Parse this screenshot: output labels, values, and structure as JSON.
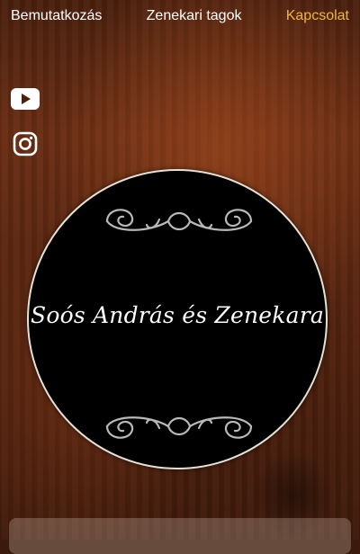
{
  "nav": {
    "items": [
      {
        "label": "Bemutatkozás"
      },
      {
        "label": "Zenekari tagok"
      },
      {
        "label": "Kapcsolat"
      }
    ],
    "active_color": "#f0b53b"
  },
  "social": {
    "youtube_icon": "youtube-icon",
    "instagram_icon": "instagram-icon"
  },
  "emblem": {
    "title": "Soós András és Zenekara"
  },
  "colors": {
    "background": "#5a2610",
    "emblem_fill": "#000000",
    "emblem_border": "#e6e1d6"
  }
}
